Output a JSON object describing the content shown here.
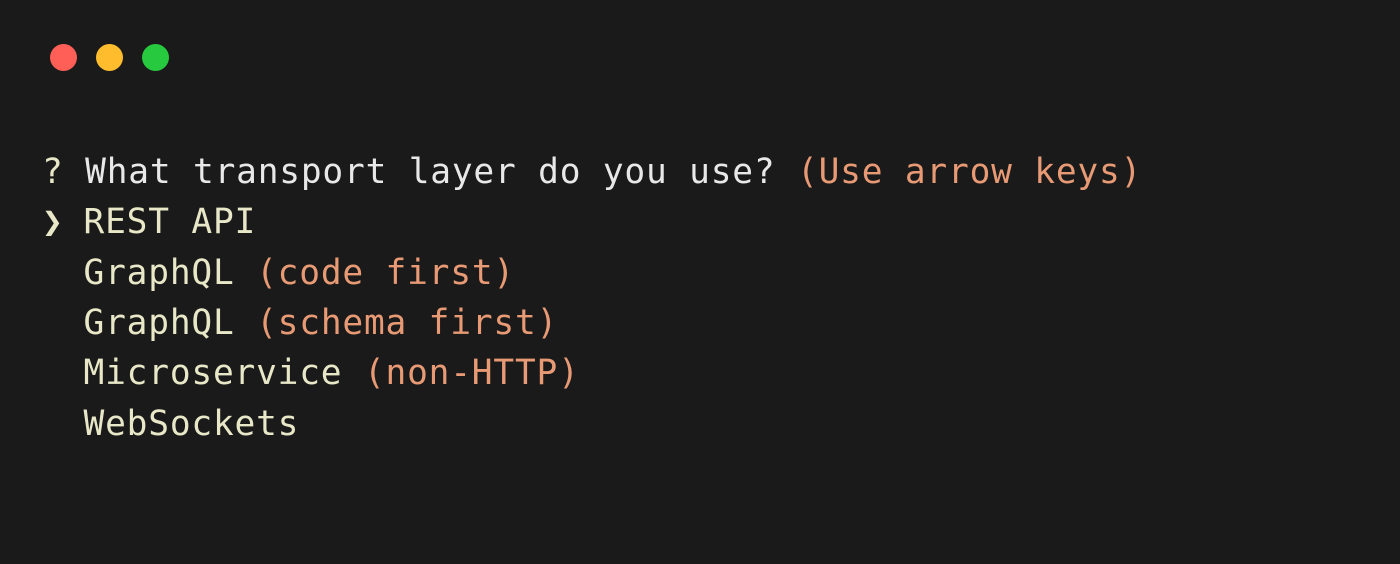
{
  "prompt": {
    "marker": "?",
    "question": "What transport layer do you use?",
    "hint": "(Use arrow keys)"
  },
  "pointer": "❯",
  "options": [
    {
      "label": "REST API",
      "detail": "",
      "selected": true
    },
    {
      "label": "GraphQL ",
      "detail": "(code first)",
      "selected": false
    },
    {
      "label": "GraphQL ",
      "detail": "(schema first)",
      "selected": false
    },
    {
      "label": "Microservice ",
      "detail": "(non-HTTP)",
      "selected": false
    },
    {
      "label": "WebSockets",
      "detail": "",
      "selected": false
    }
  ]
}
